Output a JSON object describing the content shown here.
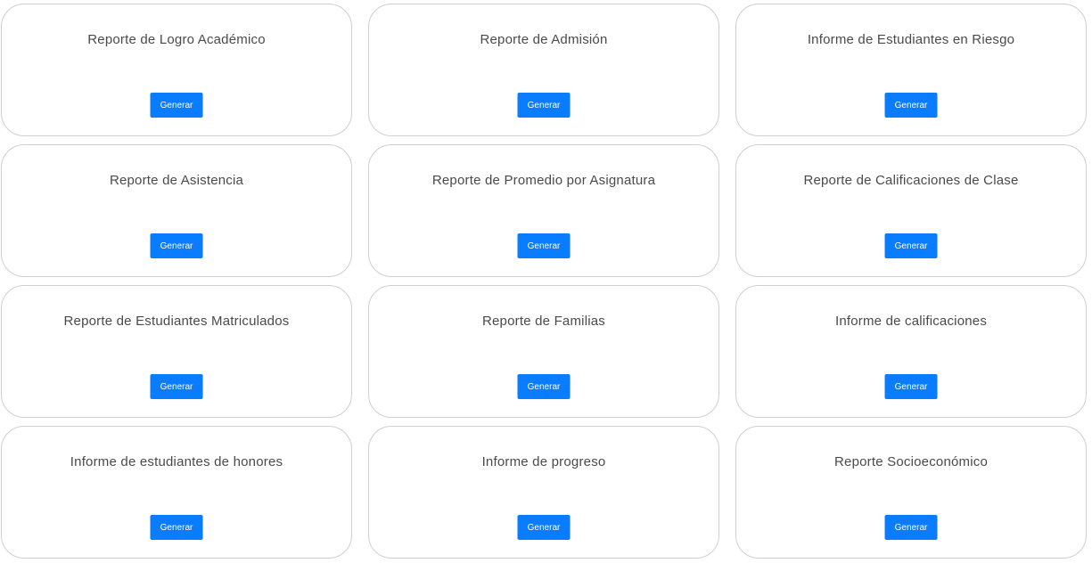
{
  "reports": [
    {
      "title": "Reporte de Logro Académico",
      "button": "Generar"
    },
    {
      "title": "Reporte de Admisión",
      "button": "Generar"
    },
    {
      "title": "Informe de Estudiantes en Riesgo",
      "button": "Generar"
    },
    {
      "title": "Reporte de Asistencia",
      "button": "Generar"
    },
    {
      "title": "Reporte de Promedio por Asignatura",
      "button": "Generar"
    },
    {
      "title": "Reporte de Calificaciones de Clase",
      "button": "Generar"
    },
    {
      "title": "Reporte de Estudiantes Matriculados",
      "button": "Generar"
    },
    {
      "title": "Reporte de Familias",
      "button": "Generar"
    },
    {
      "title": "Informe de calificaciones",
      "button": "Generar"
    },
    {
      "title": "Informe de estudiantes de honores",
      "button": "Generar"
    },
    {
      "title": "Informe de progreso",
      "button": "Generar"
    },
    {
      "title": "Reporte Socioeconómico",
      "button": "Generar"
    }
  ],
  "colors": {
    "button_bg": "#0a7cff",
    "card_border": "#cfcfcf",
    "title_text": "#4a4a4a"
  }
}
